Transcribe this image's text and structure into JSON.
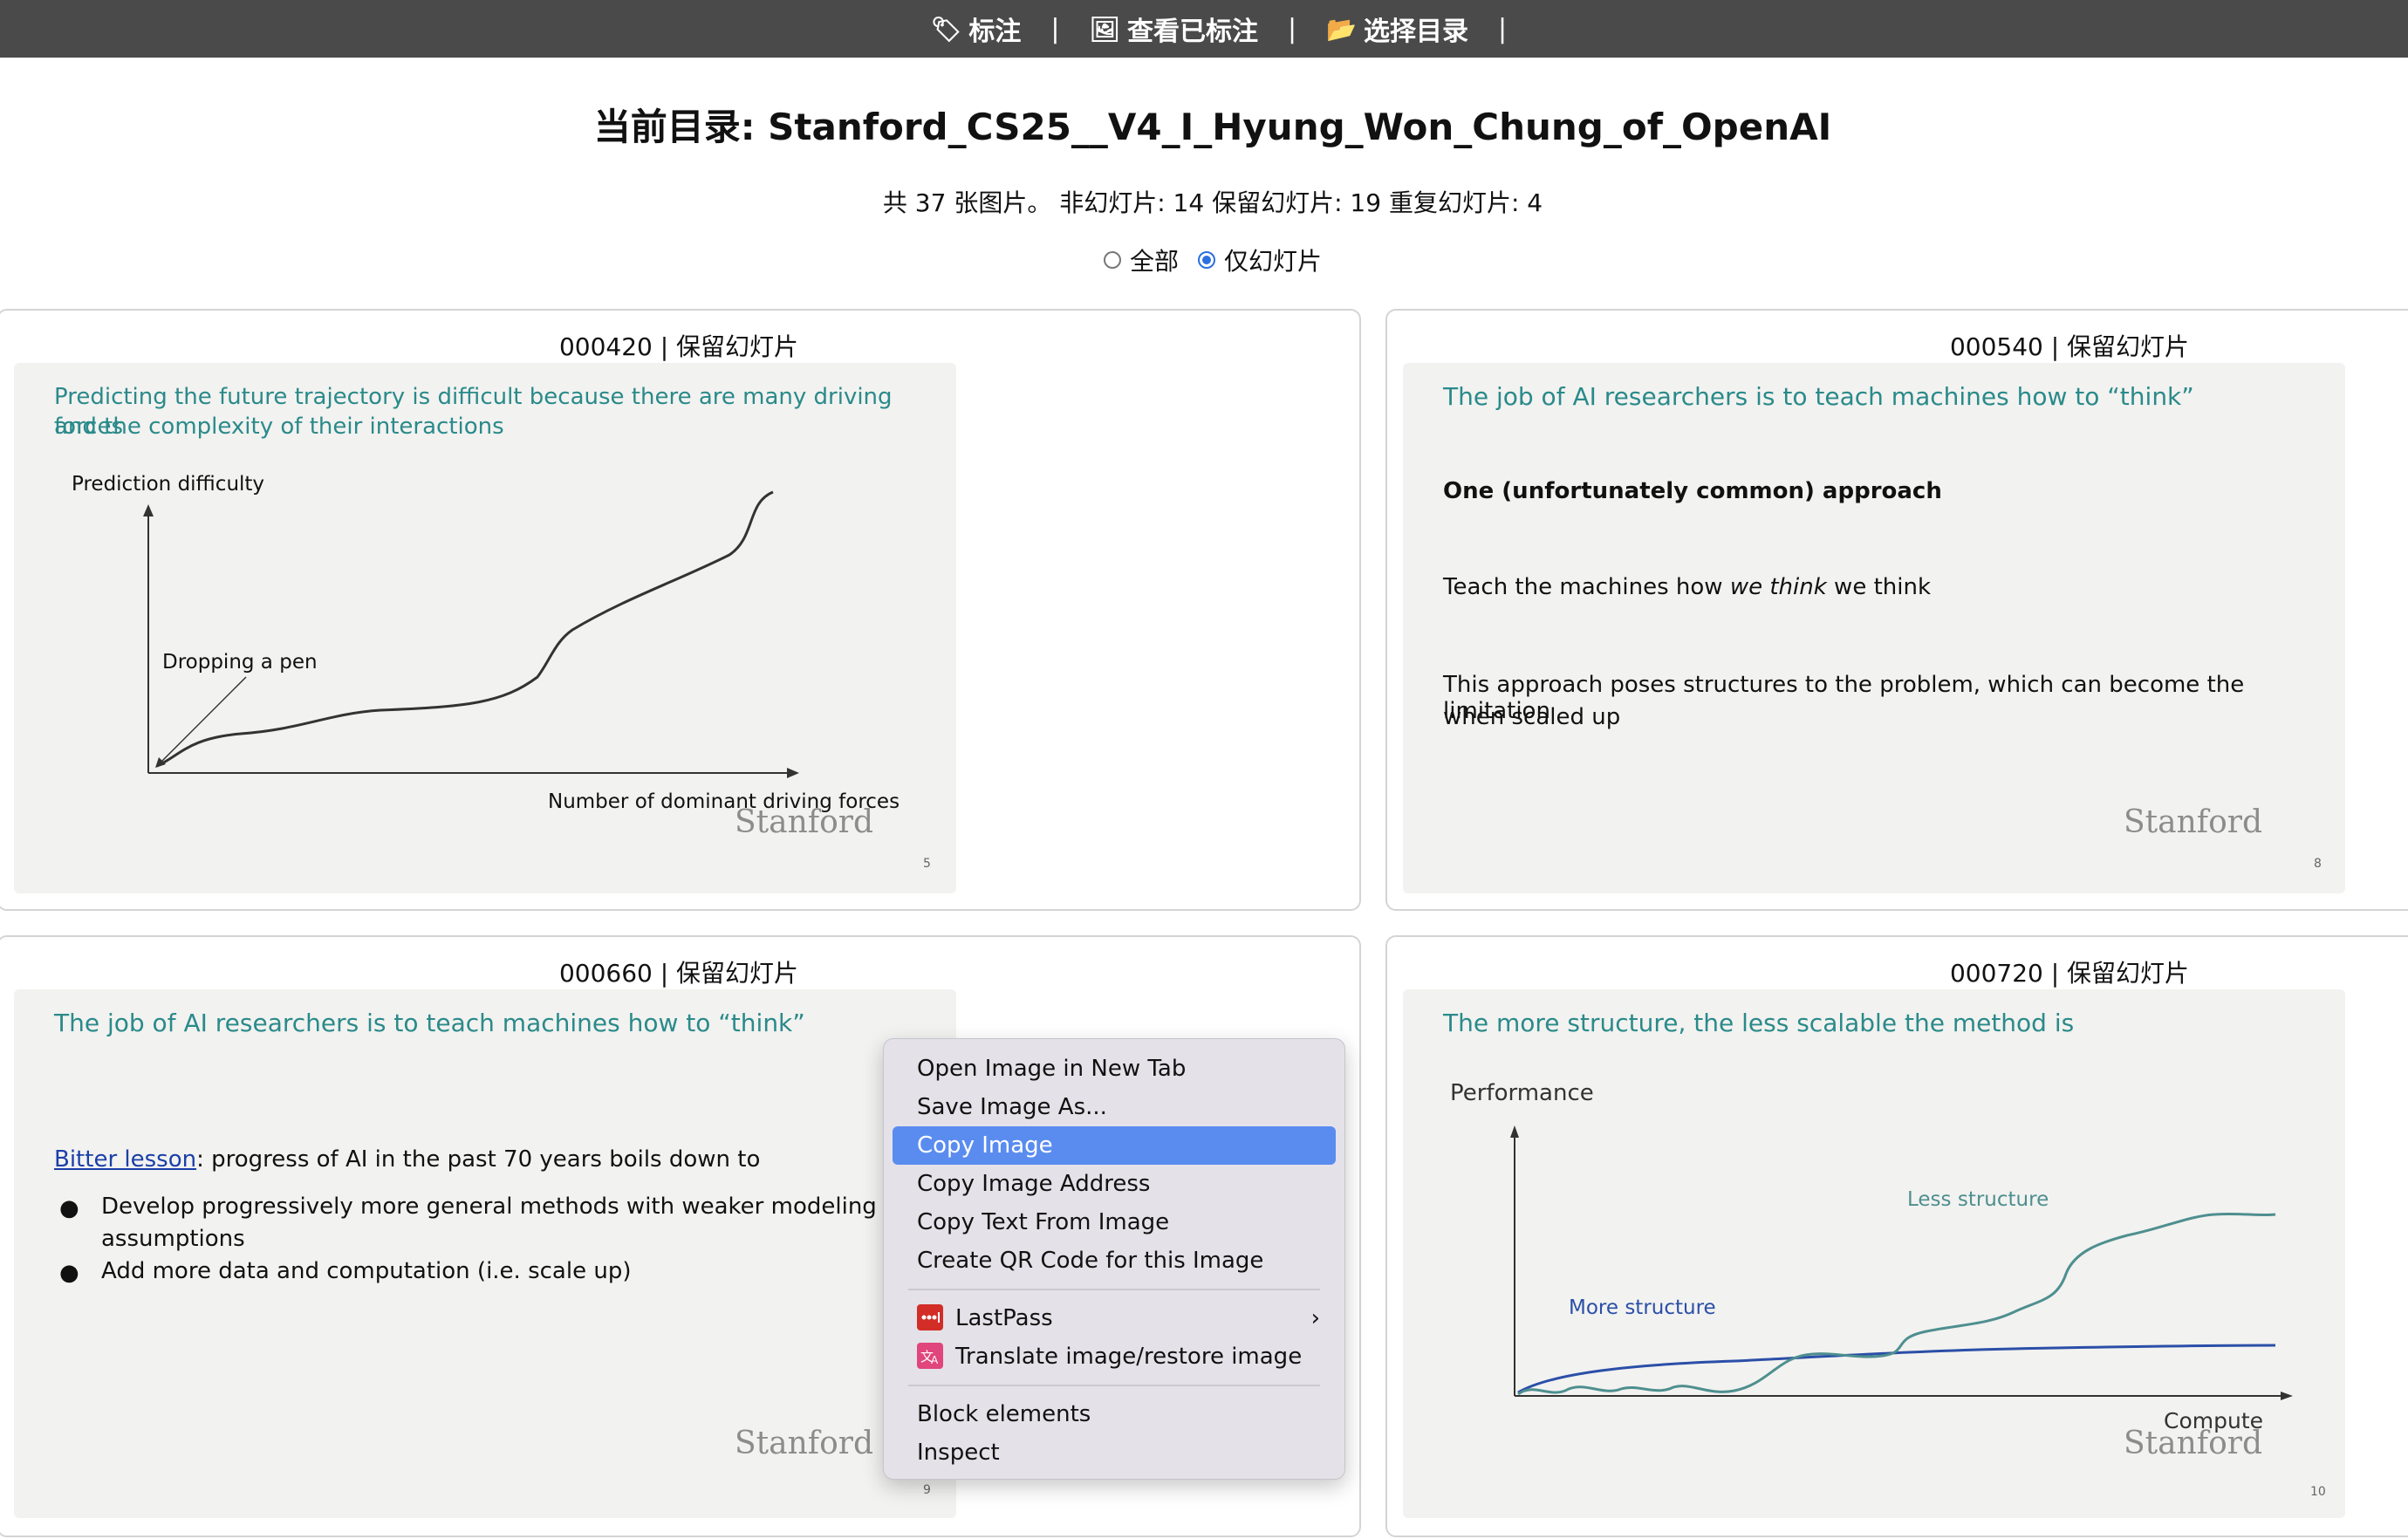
{
  "nav": {
    "items": [
      {
        "icon": "label-tag-icon",
        "glyph": "🏷",
        "label": "标注"
      },
      {
        "icon": "picture-icon",
        "glyph": "🖼",
        "label": "查看已标注"
      },
      {
        "icon": "folder-icon",
        "glyph": "📂",
        "label": "选择目录"
      }
    ],
    "separator": "|"
  },
  "page": {
    "title": "当前目录: Stanford_CS25__V4_I_Hyung_Won_Chung_of_OpenAI",
    "summary": "共 37 张图片。 非幻灯片: 14 保留幻灯片: 19 重复幻灯片: 4",
    "filter": {
      "all_label": "全部",
      "slides_label": "仅幻灯片",
      "selected": "slides"
    }
  },
  "cards": [
    {
      "header": "000420 | 保留幻灯片",
      "slide": {
        "title_line1": "Predicting the future trajectory is difficult because there are many driving forces",
        "title_line2": "and the complexity of their interactions",
        "y_label": "Prediction difficulty",
        "annotation": "Dropping a pen",
        "x_label": "Number of dominant driving forces",
        "logo": "Stanford",
        "number": "5"
      }
    },
    {
      "header": "000540 | 保留幻灯片",
      "slide": {
        "title": "The job of AI researchers is to teach machines how to “think”",
        "heading": "One (unfortunately common) approach",
        "line_pre": "Teach the machines how ",
        "line_em": "we think",
        "line_post": " we think",
        "para_line1": "This approach poses structures to the problem, which can become the limitation",
        "para_line2": "when scaled up",
        "logo": "Stanford",
        "number": "8"
      }
    },
    {
      "header": "000660 | 保留幻灯片",
      "slide": {
        "title": "The job of AI researchers is to teach machines how to “think”",
        "link": "Bitter lesson",
        "intro": ": progress of AI in the past 70 years boils down to",
        "bullet1_line1": "Develop progressively more general methods with weaker modeling",
        "bullet1_line2": "assumptions",
        "bullet2": "Add more data and computation (i.e. scale up)",
        "logo": "Stanford",
        "number": "9"
      }
    },
    {
      "header": "000720 | 保留幻灯片",
      "slide": {
        "title": "The more structure, the less scalable the method is",
        "y_label": "Performance",
        "less_label": "Less structure",
        "more_label": "More structure",
        "x_label": "Compute",
        "logo": "Stanford",
        "number": "10"
      }
    }
  ],
  "context_menu": {
    "items": [
      "Open Image in New Tab",
      "Save Image As...",
      "Copy Image",
      "Copy Image Address",
      "Copy Text From Image",
      "Create QR Code for this Image"
    ],
    "active": "Copy Image",
    "extensions": [
      {
        "label": "LastPass",
        "icon": "lastpass-icon",
        "color": "#d32d27",
        "has_submenu": true
      },
      {
        "label": "Translate image/restore image",
        "icon": "translate-icon",
        "color": "#e0457b",
        "has_submenu": false
      }
    ],
    "tools": [
      "Block elements",
      "Inspect"
    ]
  },
  "colors": {
    "nav_bg": "#4a4a4a",
    "slide_title": "#2a8a8a",
    "link": "#1a3fa8",
    "less_structure_curve": "#4e8f8f",
    "more_structure_curve": "#2b4fa8",
    "menu_highlight": "#5a8cf0"
  }
}
